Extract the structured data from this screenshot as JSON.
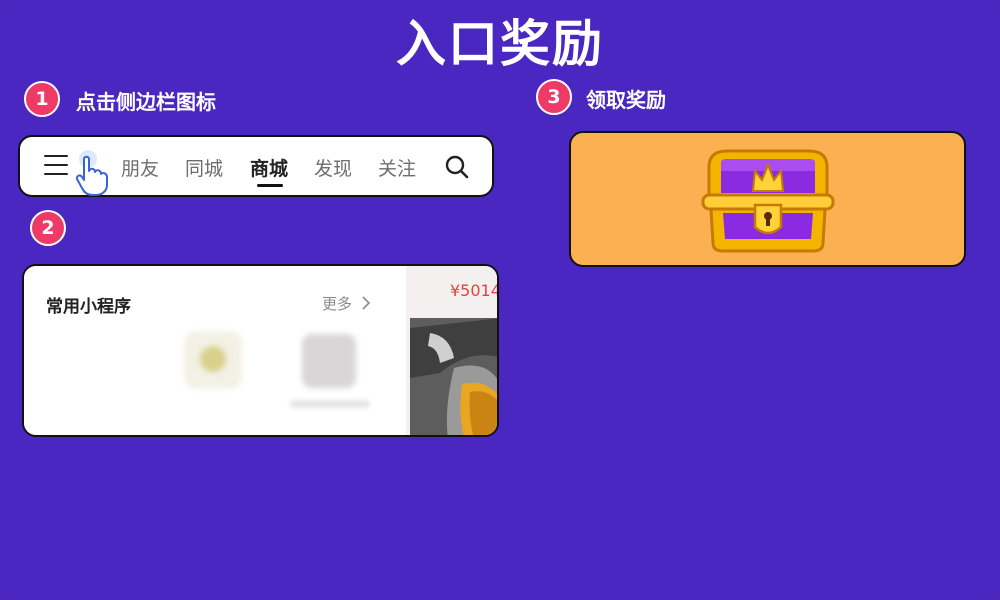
{
  "page": {
    "title": "入口奖励"
  },
  "steps": [
    {
      "number": "1",
      "text": "点击侧边栏图标"
    },
    {
      "number": "2",
      "text": ""
    },
    {
      "number": "3",
      "text": "领取奖励"
    }
  ],
  "tabbar": {
    "tabs": [
      {
        "label": "朋友"
      },
      {
        "label": "同城"
      },
      {
        "label": "商城",
        "active": true
      },
      {
        "label": "发现"
      },
      {
        "label": "关注"
      }
    ],
    "icons": {
      "menu": "menu-icon",
      "hand": "hand-pointer-icon",
      "search": "search-icon"
    }
  },
  "mini_programs": {
    "title": "常用小程序",
    "more": "更多",
    "price": "¥5014"
  },
  "reward": {
    "icon": "treasure-chest-icon"
  },
  "colors": {
    "background": "#4a27c0",
    "badge": "#ee3a67",
    "reward_bg": "#fbb152",
    "price": "#e8413b"
  }
}
